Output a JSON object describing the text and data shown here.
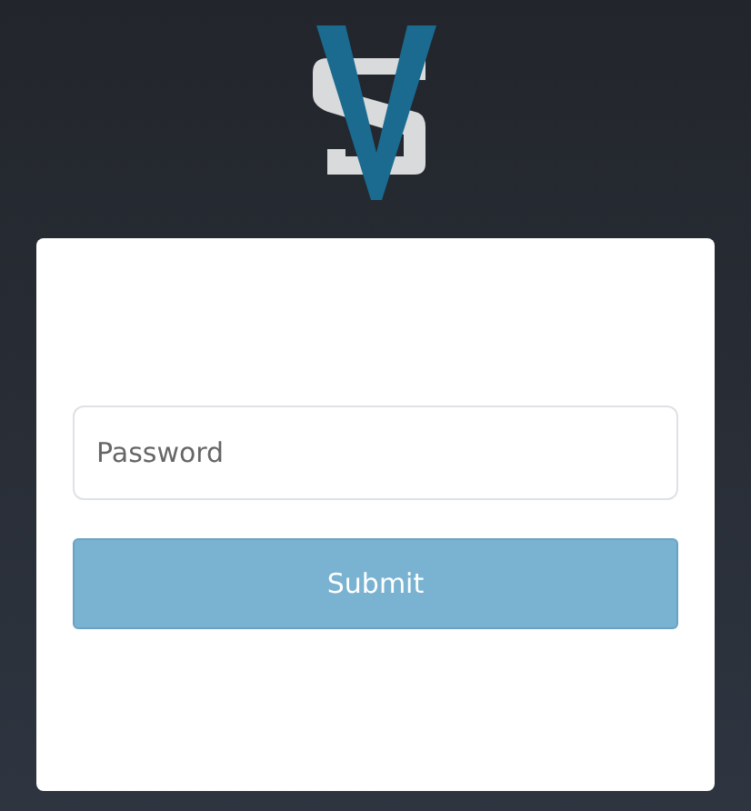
{
  "password_field": {
    "placeholder": "Password"
  },
  "submit_button": {
    "label": "Submit",
    "disabled": true
  }
}
